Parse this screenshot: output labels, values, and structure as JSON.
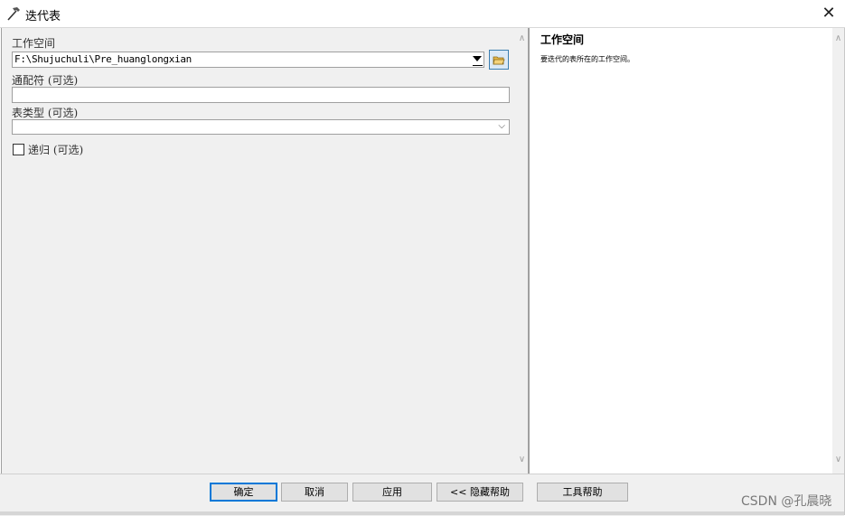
{
  "window": {
    "title": "迭代表",
    "close_glyph": "✕"
  },
  "params": {
    "workspace": {
      "label": "工作空间",
      "value": "F:\\Shujuchuli\\Pre_huanglongxian"
    },
    "wildcard": {
      "label": "通配符 (可选)",
      "value": ""
    },
    "table_type": {
      "label": "表类型 (可选)",
      "value": ""
    },
    "recursive": {
      "label": "递归 (可选)",
      "checked": false
    }
  },
  "help": {
    "title": "工作空间",
    "text": "要迭代的表所在的工作空间。"
  },
  "buttons": {
    "ok": "确定",
    "cancel": "取消",
    "apply": "应用",
    "hide_help": "<< 隐藏帮助",
    "tool_help": "工具帮助"
  },
  "watermark": "CSDN @孔晨晓",
  "icons": {
    "app": "hammer-icon",
    "browse": "folder-open-icon"
  },
  "colors": {
    "accent": "#0078d7",
    "pane": "#f0f0f0"
  }
}
